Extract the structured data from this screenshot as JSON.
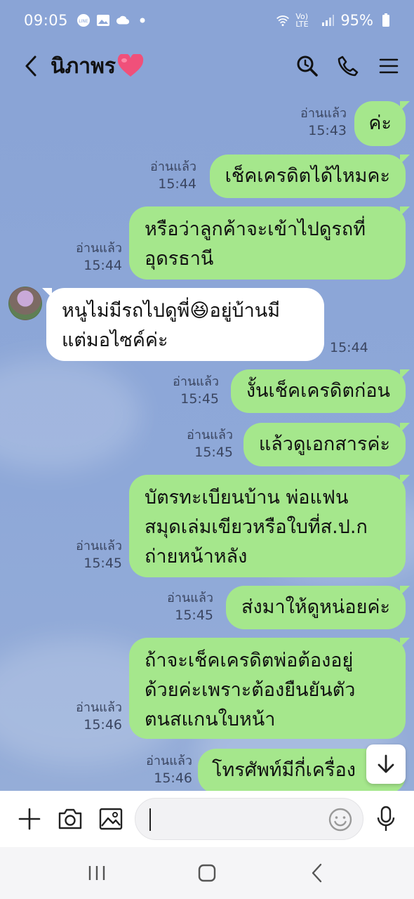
{
  "status_bar": {
    "time": "09:05",
    "battery": "95%",
    "network": "Vo) LTE"
  },
  "header": {
    "title": "นิภาพร"
  },
  "messages": [
    {
      "dir": "out",
      "lines": [
        "ค่ะ"
      ],
      "read": "อ่านแล้ว",
      "time": "15:43"
    },
    {
      "dir": "out",
      "lines": [
        "เช็คเครดิตได้ไหมคะ"
      ],
      "read": "อ่านแล้ว",
      "time": "15:44"
    },
    {
      "dir": "out",
      "lines": [
        "หรือว่าลูกค้าจะเข้าไปดูรถที่",
        "อุดรธานี"
      ],
      "read": "อ่านแล้ว",
      "time": "15:44"
    },
    {
      "dir": "in",
      "lines": [
        "หนูไม่มีรถไปดูพี่😆อยู่บ้านมี",
        "แต่มอไซค์ค่ะ"
      ],
      "time": "15:44"
    },
    {
      "dir": "out",
      "lines": [
        "งั้นเช็คเครดิตก่อน"
      ],
      "read": "อ่านแล้ว",
      "time": "15:45"
    },
    {
      "dir": "out",
      "lines": [
        "แล้วดูเอกสารค่ะ"
      ],
      "read": "อ่านแล้ว",
      "time": "15:45"
    },
    {
      "dir": "out",
      "lines": [
        "บัตรทะเบียนบ้าน พ่อแฟน",
        "สมุดเล่มเขียวหรือใบที่ส.ป.ก",
        "ถ่ายหน้าหลัง"
      ],
      "read": "อ่านแล้ว",
      "time": "15:45"
    },
    {
      "dir": "out",
      "lines": [
        "ส่งมาให้ดูหน่อยค่ะ"
      ],
      "read": "อ่านแล้ว",
      "time": "15:45"
    },
    {
      "dir": "out",
      "lines": [
        "ถ้าจะเช็คเครดิตพ่อต้องอยู่",
        "ด้วยค่ะเพราะต้องยืนยันตัว",
        "ตนสแกนใบหน้า"
      ],
      "read": "อ่านแล้ว",
      "time": "15:46"
    },
    {
      "dir": "out",
      "lines": [
        "โทรศัพท์มีกี่เครื่อง"
      ],
      "read": "อ่านแล้ว",
      "time": "15:46"
    }
  ],
  "icons": {
    "back": "chevron-left-icon",
    "search": "search-icon",
    "call": "phone-icon",
    "menu": "menu-icon",
    "scroll_down": "arrow-down-icon",
    "add": "plus-icon",
    "camera": "camera-icon",
    "gallery": "image-icon",
    "emoji": "smiley-icon",
    "mic": "microphone-icon"
  },
  "colors": {
    "background": "#8aa4d6",
    "outgoing_bubble": "#a5e78c",
    "incoming_bubble": "#ffffff",
    "heart": "#f0507a"
  }
}
